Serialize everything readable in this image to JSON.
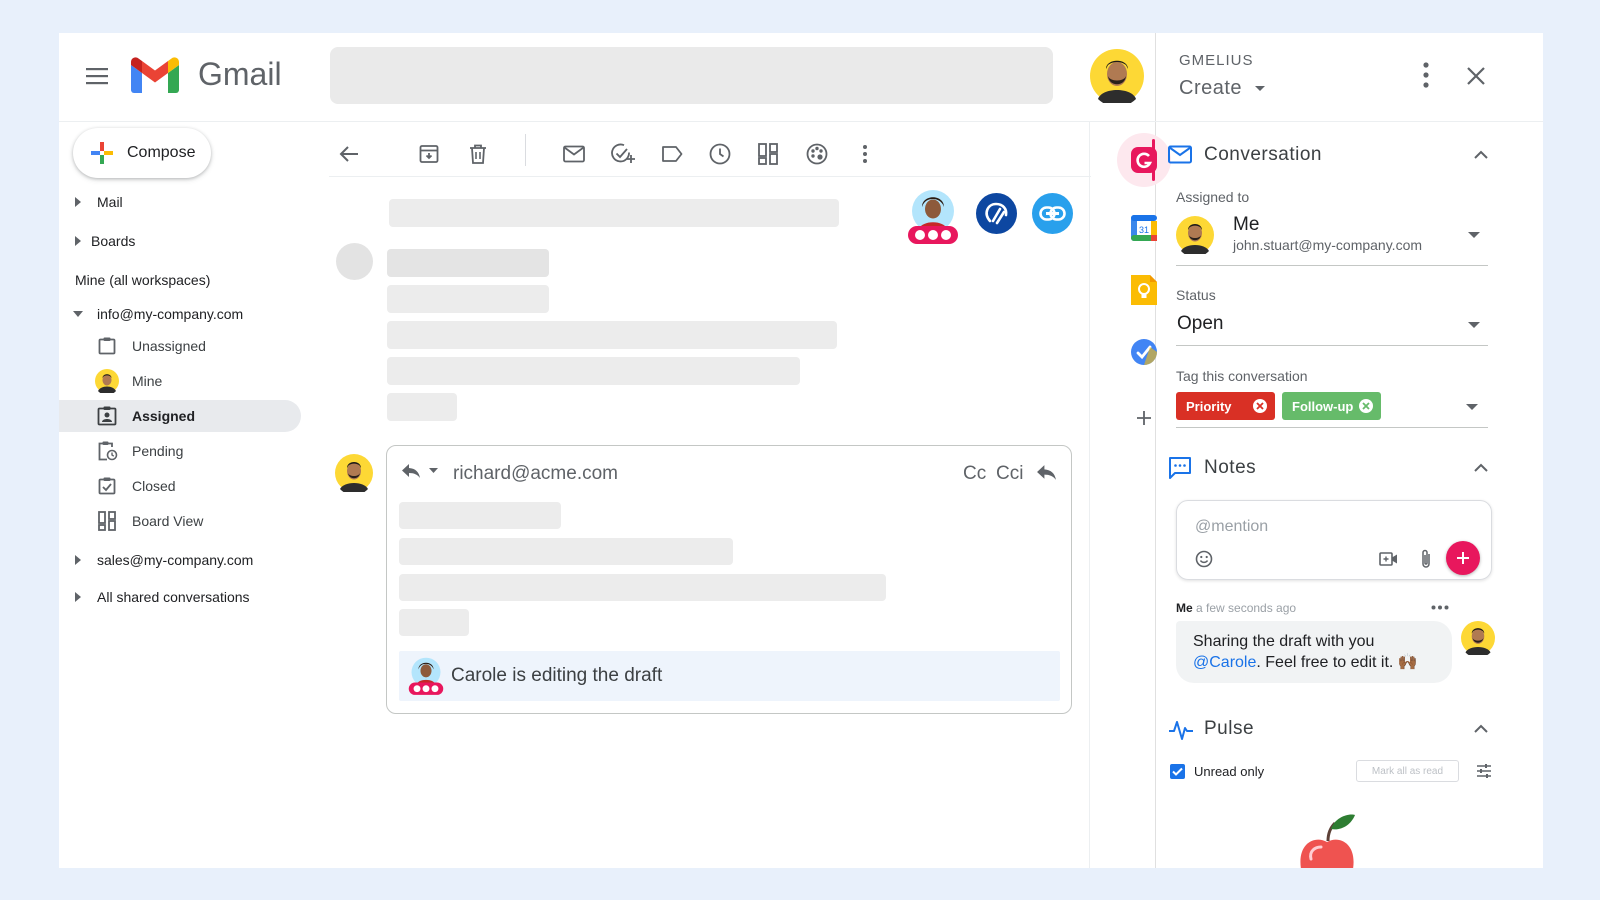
{
  "app": {
    "name": "Gmail"
  },
  "sidebar": {
    "compose_label": "Compose",
    "mail_label": "Mail",
    "boards_label": "Boards",
    "mine_all_label": "Mine (all workspaces)",
    "info_account": "info@my-company.com",
    "items": [
      {
        "label": "Unassigned",
        "icon": "clipboard-icon"
      },
      {
        "label": "Mine",
        "icon": "avatar"
      },
      {
        "label": "Assigned",
        "icon": "assigned-icon"
      },
      {
        "label": "Pending",
        "icon": "pending-icon"
      },
      {
        "label": "Closed",
        "icon": "closed-icon"
      },
      {
        "label": "Board View",
        "icon": "board-icon"
      }
    ],
    "sales_account": "sales@my-company.com",
    "shared_label": "All shared conversations"
  },
  "reply": {
    "to": "richard@acme.com",
    "cc": "Cc",
    "cci": "Cci",
    "editing_status": "Carole is editing the draft"
  },
  "panel": {
    "brand": "GMELIUS",
    "create_label": "Create",
    "conversation": {
      "title": "Conversation",
      "assigned_label": "Assigned to",
      "assignee_name": "Me",
      "assignee_email": "john.stuart@my-company.com",
      "status_label": "Status",
      "status_value": "Open",
      "tag_label": "Tag this conversation",
      "tags": [
        {
          "label": "Priority",
          "color": "#d93025"
        },
        {
          "label": "Follow-up",
          "color": "#66bb6a"
        }
      ]
    },
    "notes": {
      "title": "Notes",
      "placeholder": "@mention",
      "author": "Me",
      "time": "a few seconds ago",
      "text_before": "Sharing the draft with you",
      "mention": "@Carole",
      "text_after": ". Feel free to edit it. 🙌🏾"
    },
    "pulse": {
      "title": "Pulse",
      "unread_label": "Unread only",
      "mark_read_label": "Mark all as read"
    }
  },
  "colors": {
    "accent_red": "#e8175d",
    "accent_blue": "#1a73e8",
    "selected_bg": "#e8eaed",
    "note_bubble": "#f1f3f4"
  }
}
